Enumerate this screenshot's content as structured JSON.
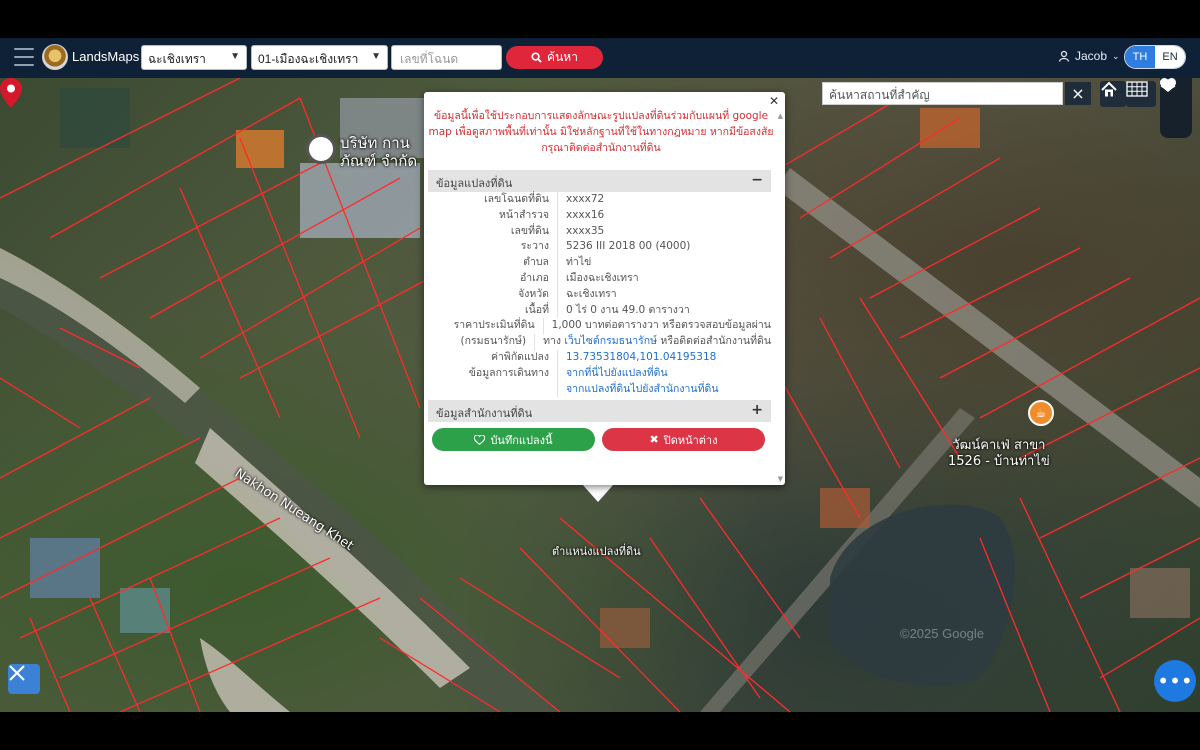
{
  "header": {
    "brand": "LandsMaps",
    "province_select": "ฉะเชิงเทรา",
    "district_select": "01-เมืองฉะเชิงเทรา",
    "deed_placeholder": "เลขที่โฉนด",
    "search_label": "ค้นหา",
    "user_name": "Jacob",
    "lang_th": "TH",
    "lang_en": "EN"
  },
  "map": {
    "place_search_placeholder": "ค้นหาสถานที่สำคัญ",
    "river_label": "Nakhon Nueang Khet",
    "place_label_line1": "วัฒน์คาเฟ่ สาขา",
    "place_label_line2": "1526 - บ้านท่าไข่",
    "company_label_line1": "บริษัท กาน",
    "company_label_line2": "ภัณฑ์ จำกัด",
    "pin_label": "ตำแหน่งแปลงที่ดิน",
    "watermark": "©2025 Google"
  },
  "popup": {
    "notice": "ข้อมูลนี้เพื่อใช้ประกอบการแสดงลักษณะรูปแปลงที่ดินร่วมกับแผนที่ google map เพื่อดูสภาพพื้นที่เท่านั้น มิใช่หลักฐานที่ใช้ในทางกฎหมาย หากมีข้อสงสัย กรุณาติดต่อสำนักงานที่ดิน",
    "section_parcel": "ข้อมูลแปลงที่ดิน",
    "section_office": "ข้อมูลสำนักงานที่ดิน",
    "rows": [
      {
        "label": "เลขโฉนดที่ดิน",
        "value": "xxxx72"
      },
      {
        "label": "หน้าสำรวจ",
        "value": "xxxx16"
      },
      {
        "label": "เลขที่ดิน",
        "value": "xxxx35"
      },
      {
        "label": "ระวาง",
        "value": "5236 III 2018 00 (4000)"
      },
      {
        "label": "ตำบล",
        "value": "ท่าไข่"
      },
      {
        "label": "อำเภอ",
        "value": "เมืองฉะเชิงเทรา"
      },
      {
        "label": "จังหวัด",
        "value": "ฉะเชิงเทรา"
      },
      {
        "label": "เนื้อที่",
        "value": "0 ไร่ 0 งาน 49.0 ตารางวา"
      },
      {
        "label": "ราคาประเมินที่ดิน",
        "value": "1,000 บาทต่อตารางวา หรือตรวจสอบข้อมูลผ่าน"
      }
    ],
    "dept_label": "(กรมธนารักษ์)",
    "dept_prefix": "ทาง",
    "dept_link": "เว็บไซต์กรมธนารักษ์",
    "dept_suffix": "หรือติดต่อสำนักงานที่ดิน",
    "coord_label": "ค่าพิกัดแปลง",
    "coord_value": "13.73531804,101.04195318",
    "travel_label": "ข้อมูลการเดินทาง",
    "travel_link1": "จากที่นี่ไปยังแปลงที่ดิน",
    "travel_link2": "จากแปลงที่ดินไปยังสำนักงานที่ดิน",
    "save_button": "บันทึกแปลงนี้",
    "close_button": "ปิดหน้าต่าง"
  }
}
